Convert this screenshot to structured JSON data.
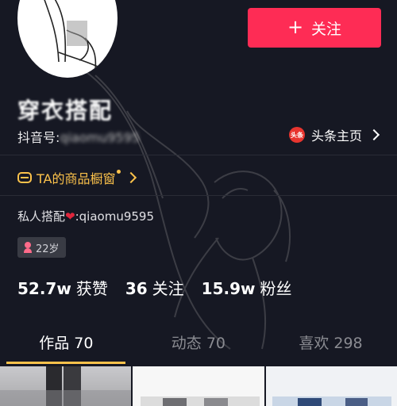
{
  "header": {
    "follow_label": "关注",
    "follow_icon": "plus-icon"
  },
  "profile": {
    "nickname": "穿衣搭配",
    "douyin_id_label": "抖音号:",
    "douyin_id_value": "qiaomu9595",
    "toutiao_icon_text": "头条",
    "toutiao_label": "头条主页",
    "shop_label": "TA的商品橱窗",
    "bio_prefix": "私人搭配",
    "bio_suffix": ":qiaomu9595",
    "age": "22岁"
  },
  "stats": [
    {
      "num": "52.7w",
      "label": "获赞"
    },
    {
      "num": "36",
      "label": "关注"
    },
    {
      "num": "15.9w",
      "label": "粉丝"
    }
  ],
  "tabs": [
    {
      "label": "作品 70"
    },
    {
      "label": "动态 70"
    },
    {
      "label": "喜欢 298"
    }
  ],
  "colors": {
    "background": "#161823",
    "follow": "#fe2c55",
    "accent": "#fcc24b"
  }
}
